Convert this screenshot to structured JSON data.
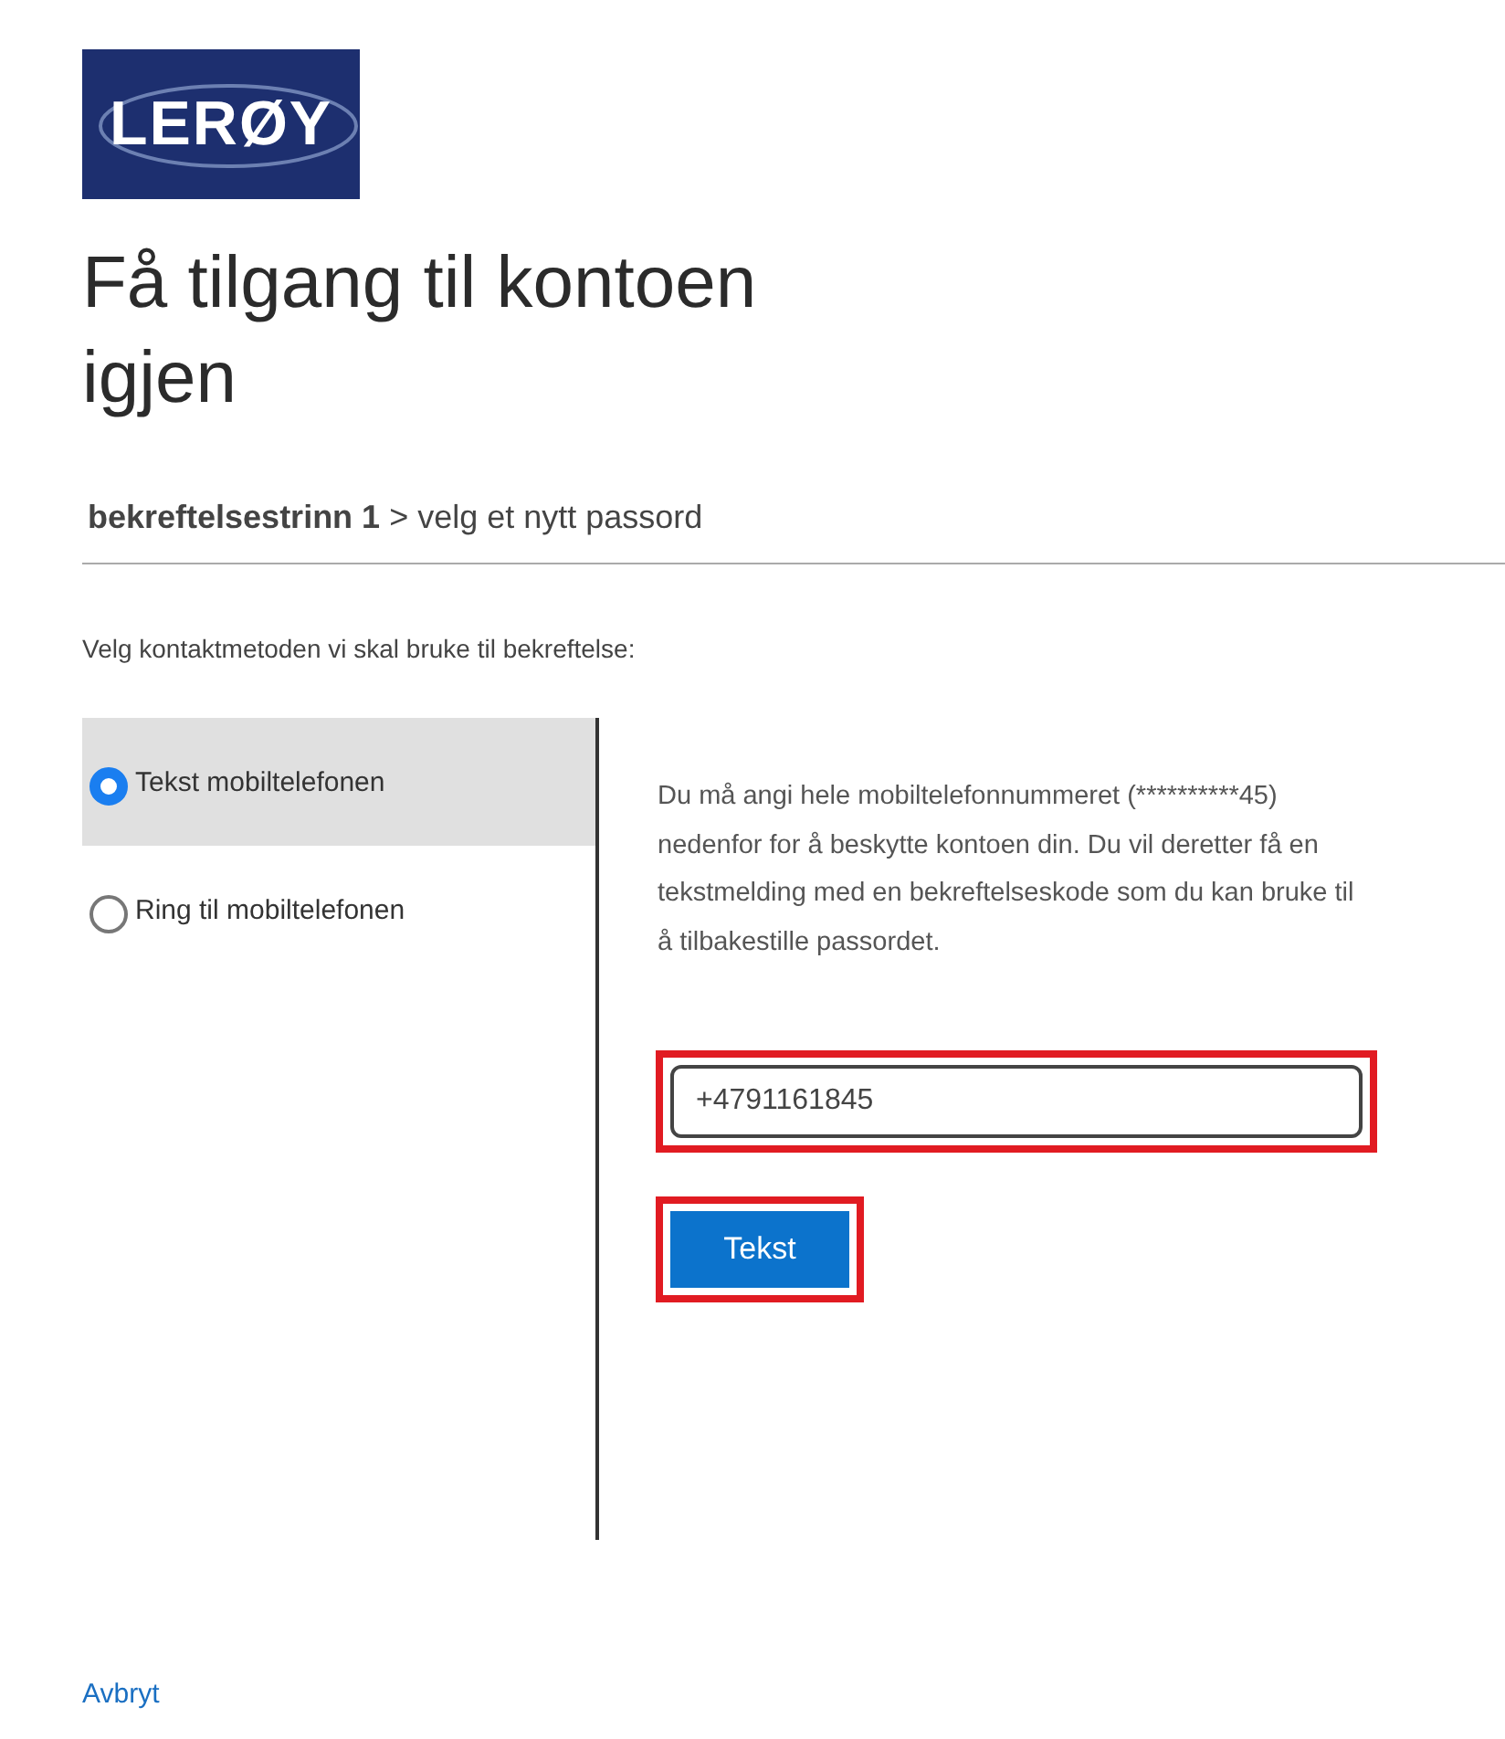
{
  "logo": {
    "text": "LERØY"
  },
  "title": "Få tilgang til kontoen igjen",
  "breadcrumb": "**bekreftelsestrinn 1** > velg et nytt passord",
  "instruction": "Velg kontaktmetoden vi skal bruke til bekreftelse:",
  "options": [
    {
      "label": "Tekst mobiltelefonen",
      "selected": true
    },
    {
      "label": "Ring til mobiltelefonen",
      "selected": false
    }
  ],
  "description": "Du må angi hele mobiltelefonnummeret (**********45) nedenfor for å beskytte kontoen din. Du vil deretter få en tekstmelding med en bekreftelseskode som du kan bruke til å tilbakestille passordet.",
  "phone_field": {
    "value": "+4791161845",
    "highlighted": true
  },
  "submit_button": {
    "label": "Tekst",
    "highlighted": true
  },
  "cancel_link": "Avbryt"
}
